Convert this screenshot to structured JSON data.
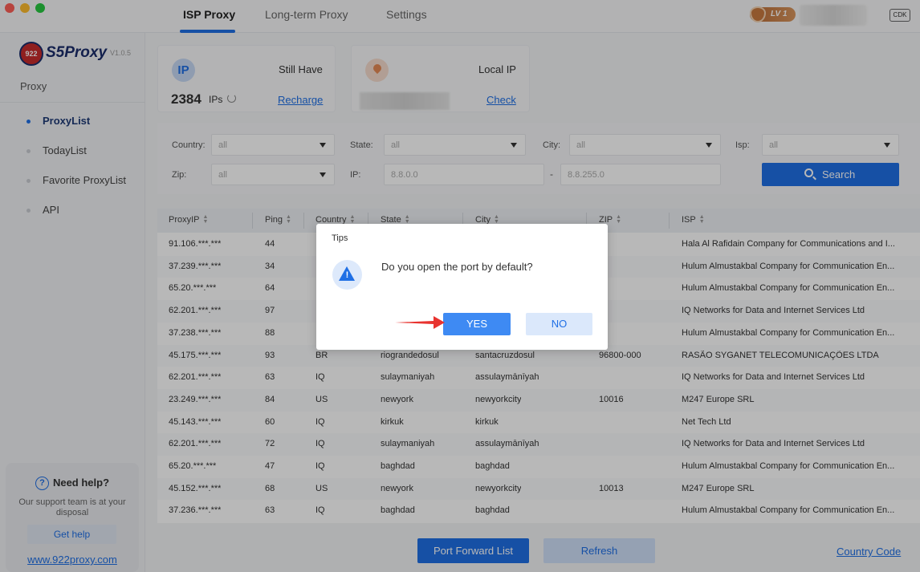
{
  "tabs": [
    {
      "label": "ISP Proxy",
      "active": true
    },
    {
      "label": "Long-term Proxy",
      "active": false
    },
    {
      "label": "Settings",
      "active": false
    }
  ],
  "user": {
    "level": "LV 1",
    "cdk_label": "CDK"
  },
  "brand": {
    "logo_mark": "922",
    "name": "S5Proxy",
    "version": "V1.0.5"
  },
  "sidebar": {
    "section": "Proxy",
    "items": [
      {
        "label": "ProxyList",
        "active": true
      },
      {
        "label": "TodayList",
        "active": false
      },
      {
        "label": "Favorite ProxyList",
        "active": false
      },
      {
        "label": "API",
        "active": false
      }
    ],
    "help": {
      "title": "Need help?",
      "icon": "question-icon",
      "desc": "Our support team is at your disposal",
      "button": "Get help",
      "link": "www.922proxy.com"
    }
  },
  "stats": {
    "ip_badge": "IP",
    "still_have_label": "Still Have",
    "ip_count": "2384",
    "ip_unit": "IPs",
    "recharge_link": "Recharge",
    "local_ip_label": "Local IP",
    "check_link": "Check"
  },
  "filters": {
    "country_label": "Country:",
    "country_value": "all",
    "state_label": "State:",
    "state_value": "all",
    "city_label": "City:",
    "city_value": "all",
    "isp_label": "Isp:",
    "isp_value": "all",
    "zip_label": "Zip:",
    "zip_value": "all",
    "ip_label": "IP:",
    "ip_from_placeholder": "8.8.0.0",
    "ip_dash": "-",
    "ip_to_placeholder": "8.8.255.0",
    "search_button": "Search"
  },
  "table": {
    "columns": [
      "ProxyIP",
      "Ping",
      "Country",
      "State",
      "City",
      "ZIP",
      "ISP"
    ],
    "rows": [
      [
        "91.106.***.***",
        "44",
        "",
        "",
        "",
        "",
        "Hala Al Rafidain Company for Communications and I..."
      ],
      [
        "37.239.***.***",
        "34",
        "",
        "",
        "",
        "",
        "Hulum Almustakbal Company for Communication En..."
      ],
      [
        "65.20.***.***",
        "64",
        "",
        "",
        "",
        "",
        "Hulum Almustakbal Company for Communication En..."
      ],
      [
        "62.201.***.***",
        "97",
        "",
        "",
        "",
        "",
        "IQ Networks for Data and Internet Services Ltd"
      ],
      [
        "37.238.***.***",
        "88",
        "",
        "",
        "",
        "",
        "Hulum Almustakbal Company for Communication En..."
      ],
      [
        "45.175.***.***",
        "93",
        "BR",
        "riograndedosul",
        "santacruzdosul",
        "96800-000",
        "RASÃO SYGANET TELECOMUNICAÇÕES LTDA"
      ],
      [
        "62.201.***.***",
        "63",
        "IQ",
        "sulaymaniyah",
        "assulaymānīyah",
        "",
        "IQ Networks for Data and Internet Services Ltd"
      ],
      [
        "23.249.***.***",
        "84",
        "US",
        "newyork",
        "newyorkcity",
        "10016",
        "M247 Europe SRL"
      ],
      [
        "45.143.***.***",
        "60",
        "IQ",
        "kirkuk",
        "kirkuk",
        "",
        "Net Tech Ltd"
      ],
      [
        "62.201.***.***",
        "72",
        "IQ",
        "sulaymaniyah",
        "assulaymānīyah",
        "",
        "IQ Networks for Data and Internet Services Ltd"
      ],
      [
        "65.20.***.***",
        "47",
        "IQ",
        "baghdad",
        "baghdad",
        "",
        "Hulum Almustakbal Company for Communication En..."
      ],
      [
        "45.152.***.***",
        "68",
        "US",
        "newyork",
        "newyorkcity",
        "10013",
        "M247 Europe SRL"
      ],
      [
        "37.236.***.***",
        "63",
        "IQ",
        "baghdad",
        "baghdad",
        "",
        "Hulum Almustakbal Company for Communication En..."
      ]
    ]
  },
  "bottom": {
    "port_forward_button": "Port Forward List",
    "refresh_button": "Refresh",
    "country_code_link": "Country Code"
  },
  "dialog": {
    "title": "Tips",
    "icon": "warning-icon",
    "message": "Do you open the port by default?",
    "yes_button": "YES",
    "no_button": "NO"
  },
  "colors": {
    "accent": "#1f6fe5",
    "brand_navy": "#1b2d6b",
    "brand_red": "#c62b2b",
    "arrow_red": "#e8332f"
  }
}
